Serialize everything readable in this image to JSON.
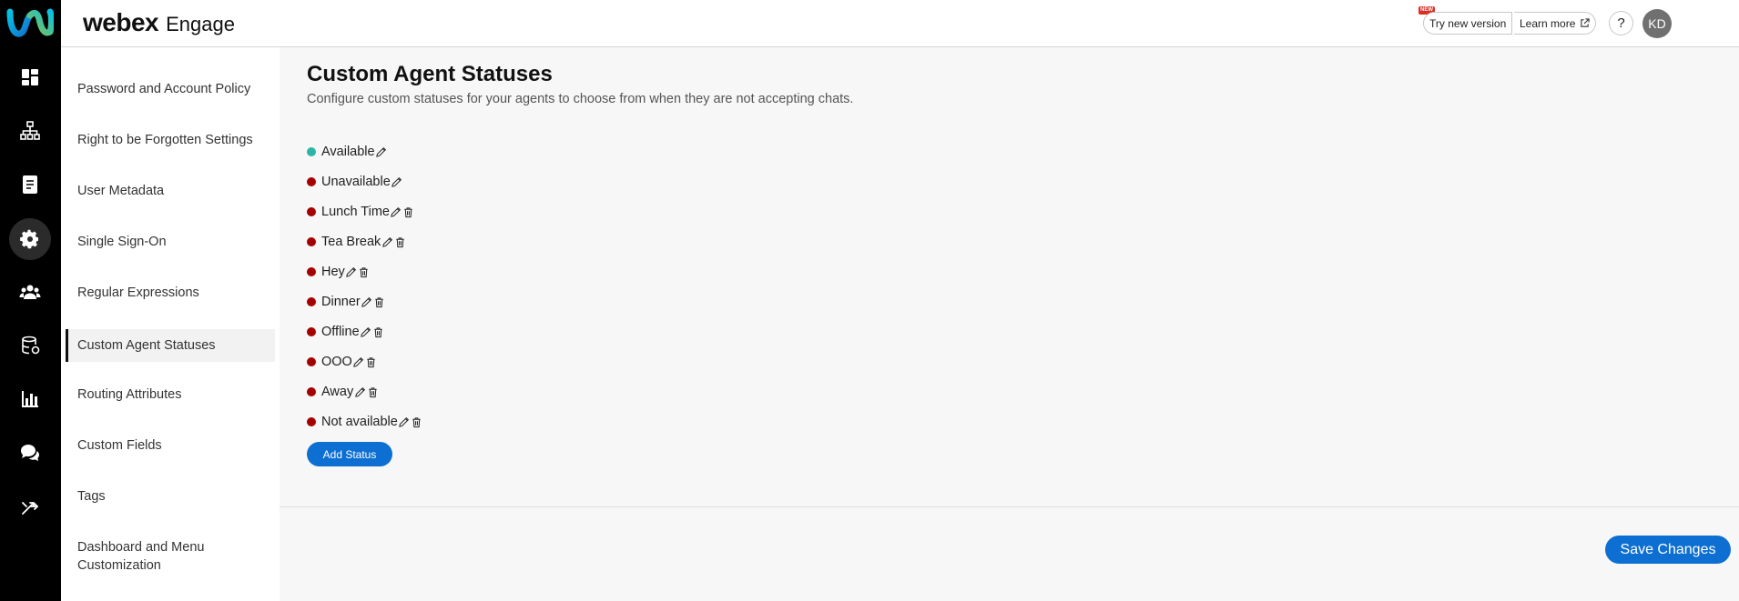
{
  "header": {
    "brand_name": "webex",
    "product_name": "Engage",
    "try_new_version": "Try new version",
    "new_badge": "NEW",
    "learn_more": "Learn more",
    "help": "?",
    "avatar_initials": "KD"
  },
  "rail": {
    "icons": [
      "webex-logo",
      "dashboard-icon",
      "org-chart-icon",
      "document-icon",
      "gear-icon",
      "team-icon",
      "database-icon",
      "bar-chart-icon",
      "chat-icon",
      "routing-icon"
    ],
    "active": "gear-icon"
  },
  "sidebar": {
    "items": [
      {
        "label": "Password and Account Policy"
      },
      {
        "label": "Right to be Forgotten Settings"
      },
      {
        "label": "User Metadata"
      },
      {
        "label": "Single Sign-On"
      },
      {
        "label": "Regular Expressions"
      },
      {
        "label": "Custom Agent Statuses"
      },
      {
        "label": "Routing Attributes"
      },
      {
        "label": "Custom Fields"
      },
      {
        "label": "Tags"
      },
      {
        "label": "Dashboard and Menu Customization"
      }
    ],
    "active_index": 5
  },
  "main": {
    "title": "Custom Agent Statuses",
    "subtitle": "Configure custom statuses for your agents to choose from when they are not accepting chats.",
    "statuses": [
      {
        "label": "Available",
        "color": "#2bb5a6",
        "deletable": false
      },
      {
        "label": "Unavailable",
        "color": "#a40000",
        "deletable": false
      },
      {
        "label": "Lunch Time",
        "color": "#a40000",
        "deletable": true
      },
      {
        "label": "Tea Break",
        "color": "#a40000",
        "deletable": true
      },
      {
        "label": "Hey",
        "color": "#a40000",
        "deletable": true
      },
      {
        "label": "Dinner",
        "color": "#a40000",
        "deletable": true
      },
      {
        "label": "Offline",
        "color": "#a40000",
        "deletable": true
      },
      {
        "label": "OOO",
        "color": "#a40000",
        "deletable": true
      },
      {
        "label": "Away",
        "color": "#a40000",
        "deletable": true
      },
      {
        "label": "Not available",
        "color": "#a40000",
        "deletable": true
      }
    ],
    "add_status": "Add Status",
    "save_changes": "Save Changes"
  },
  "colors": {
    "accent": "#0d6fd1",
    "rail_bg": "#000000",
    "available": "#2bb5a6",
    "unavailable": "#a40000"
  }
}
